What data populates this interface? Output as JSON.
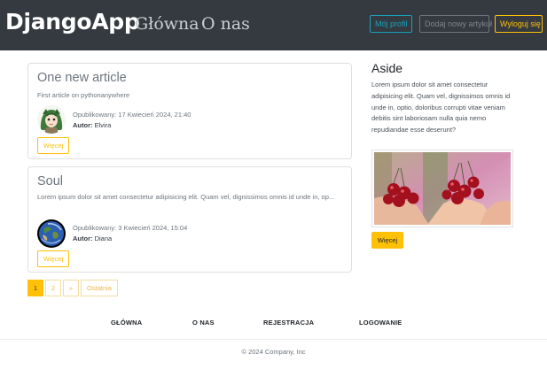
{
  "header": {
    "brand": "DjangoApp",
    "nav": [
      "Główna",
      "O nas"
    ],
    "buttons": {
      "profile": "Mój profil",
      "new_article": "Dodaj nowy artykuł",
      "logout": "Wyloguj się"
    }
  },
  "articles": [
    {
      "title": "One new article",
      "excerpt": "First article on pythonanywhere",
      "published": "Opublikowany: 17 Kwiecień 2024, 21:40",
      "author_label": "Autor:",
      "author": "Elvira",
      "more": "Więcej",
      "avatar_icon": "girl-avatar"
    },
    {
      "title": "Soul",
      "excerpt": "Lorem ipsum dolor sit amet consectetur adipisicing elit. Quam vel, dignissimos omnis id unde in, op...",
      "published": "Opublikowany: 3 Kwiecień 2024, 15:04",
      "author_label": "Autor:",
      "author": "Diana",
      "more": "Więcej",
      "avatar_icon": "earth-avatar"
    }
  ],
  "pagination": {
    "pages": [
      "1",
      "2"
    ],
    "next": "»",
    "last": "Ostatnia",
    "active": "1"
  },
  "aside": {
    "title": "Aside",
    "text": "Lorem ipsum dolor sit amet consectetur adipisicing elit. Quam vel, dignissimos omnis id unde in, optio, doloribus corrupti vitae veniam debitis sint laboriosam nulla quia nemo repudiandae esse deserunt?",
    "image_icon": "cherries-in-hands-image",
    "more": "Więcej"
  },
  "footer": {
    "nav": [
      "GŁÓWNA",
      "O NAS",
      "REJESTRACJA",
      "LOGOWANIE"
    ],
    "copyright": "© 2024 Company, Inc"
  },
  "colors": {
    "navbar": "#343a40",
    "warning": "#ffc107",
    "info": "#17a2b8",
    "secondary": "#6c757d"
  }
}
